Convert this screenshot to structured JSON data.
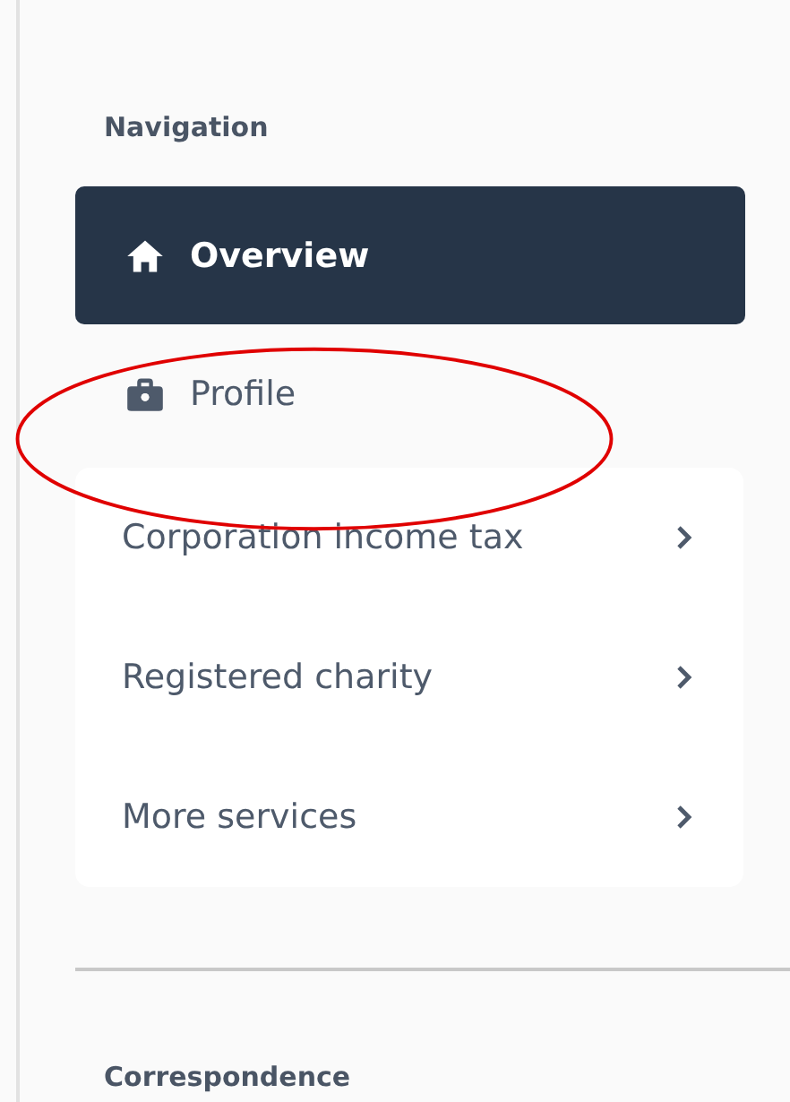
{
  "navigation": {
    "title": "Navigation",
    "items": [
      {
        "label": "Overview",
        "selected": true
      },
      {
        "label": "Profile",
        "selected": false
      }
    ],
    "services": [
      {
        "label": "Corporation income tax"
      },
      {
        "label": "Registered charity"
      },
      {
        "label": "More services"
      }
    ]
  },
  "correspondence": {
    "title": "Correspondence"
  }
}
